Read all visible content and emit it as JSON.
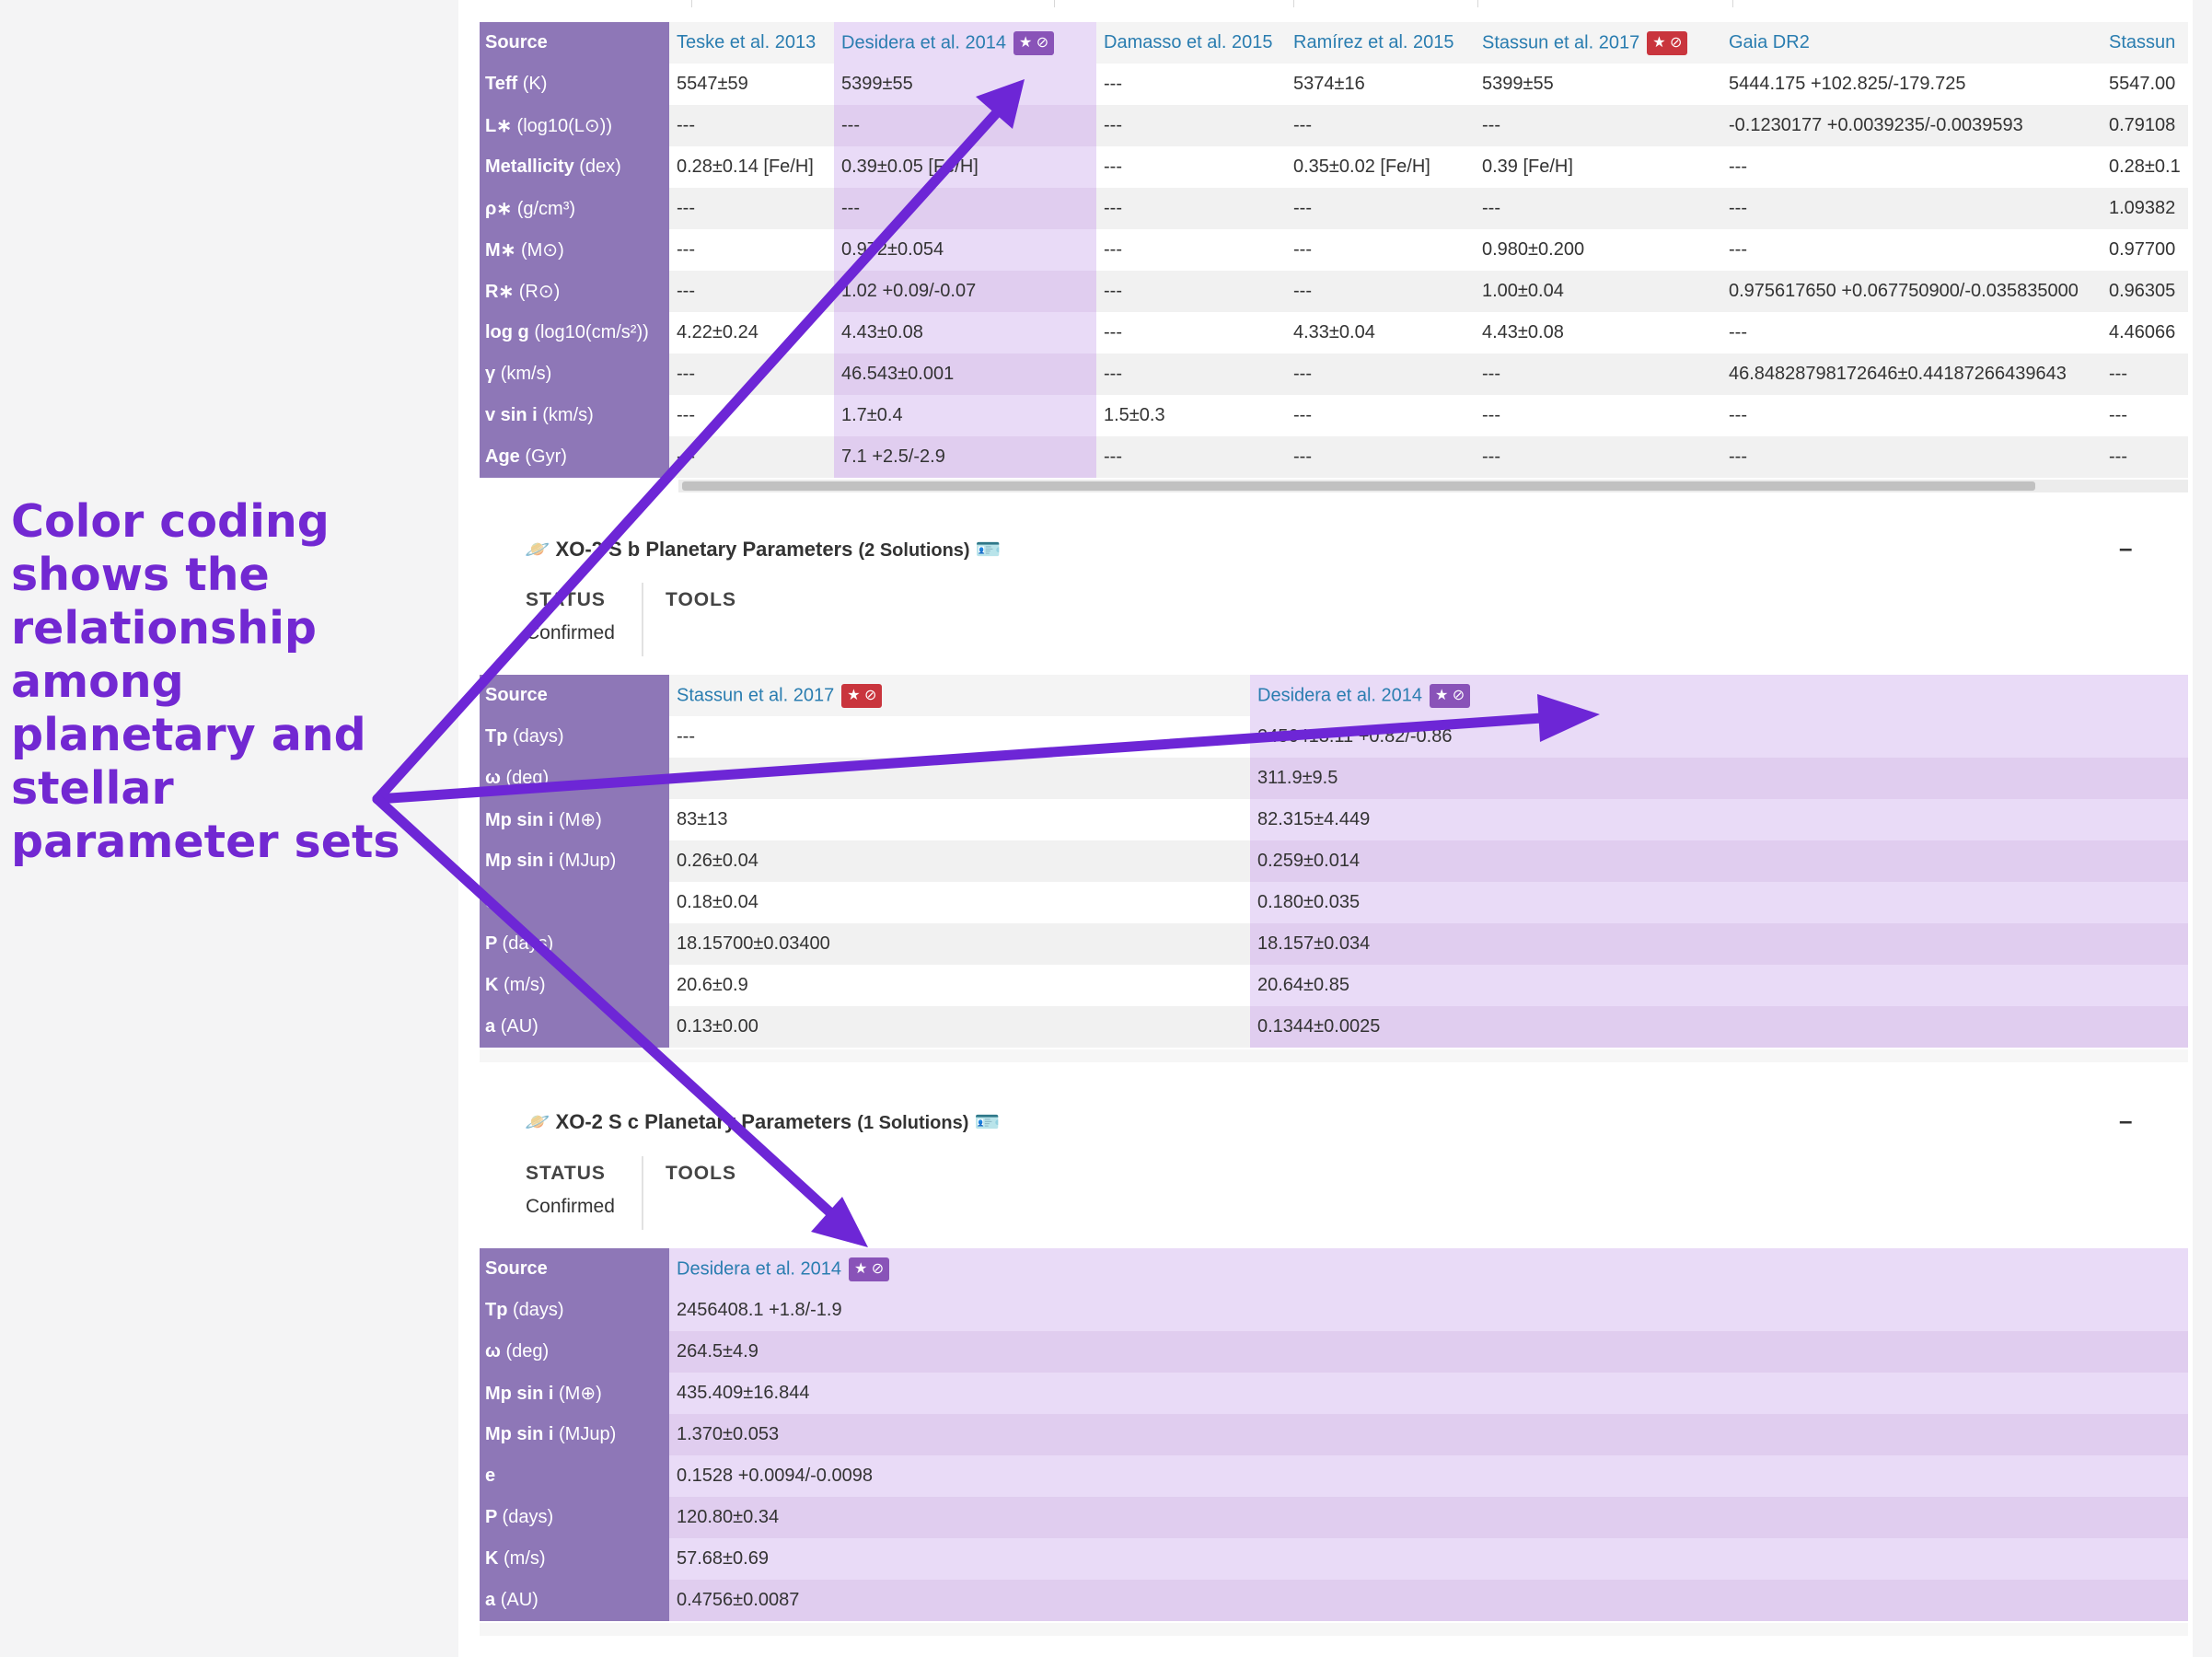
{
  "annotation": "Color coding shows the relationship among planetary and stellar parameter sets",
  "colors": {
    "accent": "#7228d2",
    "label_bg": "#8e77b7",
    "highlight": "#e9dbf7",
    "link": "#2a7db0"
  },
  "stellar": {
    "source_label": "Source",
    "sources": [
      "Teske et al. 2013",
      "Desidera et al. 2014",
      "Damasso et al. 2015",
      "Ramírez et al. 2015",
      "Stassun et al. 2017",
      "Gaia DR2",
      "Stassun"
    ],
    "rows": [
      {
        "label": "Teff",
        "unit": "(K)",
        "values": [
          "5547±59",
          "5399±55",
          "---",
          "5374±16",
          "5399±55",
          "5444.175 +102.825/-179.725",
          "5547.00"
        ]
      },
      {
        "label": "L∗",
        "unit": "(log10(L⊙))",
        "values": [
          "---",
          "---",
          "---",
          "---",
          "---",
          "-0.1230177 +0.0039235/-0.0039593",
          "0.79108"
        ]
      },
      {
        "label": "Metallicity",
        "unit": "(dex)",
        "values": [
          "0.28±0.14 [Fe/H]",
          "0.39±0.05 [Fe/H]",
          "---",
          "0.35±0.02 [Fe/H]",
          "0.39 [Fe/H]",
          "---",
          "0.28±0.1"
        ]
      },
      {
        "label": "ρ∗",
        "unit": "(g/cm³)",
        "values": [
          "---",
          "---",
          "---",
          "---",
          "---",
          "---",
          "1.09382"
        ]
      },
      {
        "label": "M∗",
        "unit": "(M⊙)",
        "values": [
          "---",
          "0.972±0.054",
          "---",
          "---",
          "0.980±0.200",
          "---",
          "0.97700"
        ]
      },
      {
        "label": "R∗",
        "unit": "(R⊙)",
        "values": [
          "---",
          "1.02 +0.09/-0.07",
          "---",
          "---",
          "1.00±0.04",
          "0.975617650 +0.067750900/-0.035835000",
          "0.96305"
        ]
      },
      {
        "label": "log g",
        "unit": "(log10(cm/s²))",
        "values": [
          "4.22±0.24",
          "4.43±0.08",
          "---",
          "4.33±0.04",
          "4.43±0.08",
          "---",
          "4.46066"
        ]
      },
      {
        "label": "γ",
        "unit": "(km/s)",
        "values": [
          "---",
          "46.543±0.001",
          "---",
          "---",
          "---",
          "46.84828798172646±0.44187266439643",
          "---"
        ]
      },
      {
        "label": "v sin i",
        "unit": "(km/s)",
        "values": [
          "---",
          "1.7±0.4",
          "1.5±0.3",
          "---",
          "---",
          "---",
          "---"
        ]
      },
      {
        "label": "Age",
        "unit": "(Gyr)",
        "values": [
          "---",
          "7.1 +2.5/-2.9",
          "---",
          "---",
          "---",
          "---",
          "---"
        ]
      }
    ]
  },
  "planet_b": {
    "title": "XO-2 S b Planetary Parameters",
    "solutions": "(2 Solutions)",
    "collapse": "–",
    "status_label": "STATUS",
    "status_value": "Confirmed",
    "tools_label": "TOOLS",
    "source_label": "Source",
    "sources": [
      "Stassun et al. 2017",
      "Desidera et al. 2014"
    ],
    "rows": [
      {
        "label": "Tp",
        "unit": "(days)",
        "values": [
          "---",
          "2456413.11 +0.82/-0.86"
        ]
      },
      {
        "label": "ω",
        "unit": "(deg)",
        "values": [
          "---",
          "311.9±9.5"
        ]
      },
      {
        "label": "Mp sin i",
        "unit": "(M⊕)",
        "values": [
          "83±13",
          "82.315±4.449"
        ]
      },
      {
        "label": "Mp sin i",
        "unit": "(MJup)",
        "values": [
          "0.26±0.04",
          "0.259±0.014"
        ]
      },
      {
        "label": "e",
        "unit": "",
        "values": [
          "0.18±0.04",
          "0.180±0.035"
        ]
      },
      {
        "label": "P",
        "unit": "(days)",
        "values": [
          "18.15700±0.03400",
          "18.157±0.034"
        ]
      },
      {
        "label": "K",
        "unit": "(m/s)",
        "values": [
          "20.6±0.9",
          "20.64±0.85"
        ]
      },
      {
        "label": "a",
        "unit": "(AU)",
        "values": [
          "0.13±0.00",
          "0.1344±0.0025"
        ]
      }
    ]
  },
  "planet_c": {
    "title": "XO-2 S c Planetary Parameters",
    "solutions": "(1 Solutions)",
    "collapse": "–",
    "status_label": "STATUS",
    "status_value": "Confirmed",
    "tools_label": "TOOLS",
    "source_label": "Source",
    "sources": [
      "Desidera et al. 2014"
    ],
    "rows": [
      {
        "label": "Tp",
        "unit": "(days)",
        "values": [
          "2456408.1 +1.8/-1.9"
        ]
      },
      {
        "label": "ω",
        "unit": "(deg)",
        "values": [
          "264.5±4.9"
        ]
      },
      {
        "label": "Mp sin i",
        "unit": "(M⊕)",
        "values": [
          "435.409±16.844"
        ]
      },
      {
        "label": "Mp sin i",
        "unit": "(MJup)",
        "values": [
          "1.370±0.053"
        ]
      },
      {
        "label": "e",
        "unit": "",
        "values": [
          "0.1528 +0.0094/-0.0098"
        ]
      },
      {
        "label": "P",
        "unit": "(days)",
        "values": [
          "120.80±0.34"
        ]
      },
      {
        "label": "K",
        "unit": "(m/s)",
        "values": [
          "57.68±0.69"
        ]
      },
      {
        "label": "a",
        "unit": "(AU)",
        "values": [
          "0.4756±0.0087"
        ]
      }
    ]
  }
}
